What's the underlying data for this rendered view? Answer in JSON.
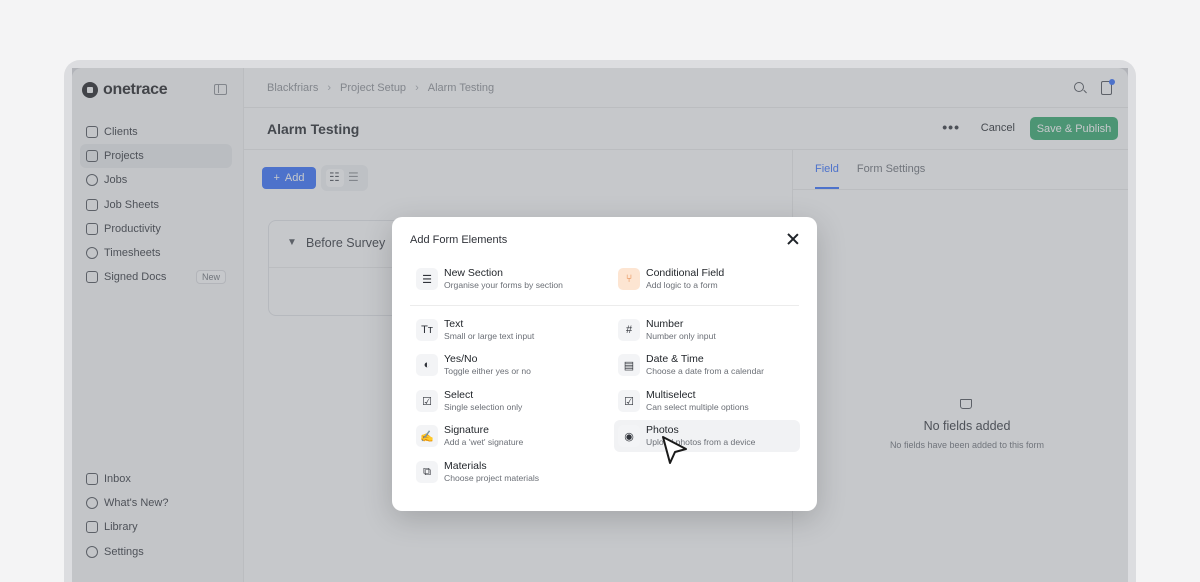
{
  "app": {
    "name": "onetrace"
  },
  "sidebar": {
    "items": [
      {
        "label": "Clients",
        "icon": "briefcase-icon"
      },
      {
        "label": "Projects",
        "icon": "cube-icon"
      },
      {
        "label": "Jobs",
        "icon": "helmet-icon"
      },
      {
        "label": "Job Sheets",
        "icon": "sheets-icon"
      },
      {
        "label": "Productivity",
        "icon": "chart-icon"
      },
      {
        "label": "Timesheets",
        "icon": "clock-icon"
      },
      {
        "label": "Signed Docs",
        "icon": "signature-icon",
        "badge": "New"
      }
    ],
    "bottom_items": [
      {
        "label": "Inbox",
        "icon": "inbox-icon"
      },
      {
        "label": "What's New?",
        "icon": "sparkle-icon"
      },
      {
        "label": "Library",
        "icon": "grid-icon"
      },
      {
        "label": "Settings",
        "icon": "gear-icon"
      }
    ],
    "active": "Projects"
  },
  "breadcrumb": [
    "Blackfriars",
    "Project Setup",
    "Alarm Testing"
  ],
  "header": {
    "title": "Alarm Testing",
    "more": "•••",
    "cancel": "Cancel",
    "publish": "Save & Publish"
  },
  "toolbar": {
    "add_label": "Add",
    "add_icon": "+"
  },
  "section": {
    "title": "Before Survey"
  },
  "panel": {
    "tabs": [
      "Field",
      "Form Settings"
    ],
    "active_tab": "Field",
    "empty_title": "No fields added",
    "empty_sub": "No fields have been added to this form"
  },
  "modal": {
    "title": "Add Form Elements",
    "options": [
      {
        "name": "New Section",
        "desc": "Organise your forms by section",
        "icon": "list-icon",
        "glyph": "☰"
      },
      {
        "name": "Conditional Field",
        "desc": "Add logic to a form",
        "icon": "branch-icon",
        "glyph": "⑂"
      },
      {
        "name": "Text",
        "desc": "Small or large text input",
        "icon": "text-icon",
        "glyph": "Tт"
      },
      {
        "name": "Number",
        "desc": "Number only input",
        "icon": "hash-icon",
        "glyph": "#"
      },
      {
        "name": "Yes/No",
        "desc": "Toggle either yes or no",
        "icon": "toggle-icon",
        "glyph": "◐"
      },
      {
        "name": "Date & Time",
        "desc": "Choose a date from a calendar",
        "icon": "calendar-icon",
        "glyph": "▤"
      },
      {
        "name": "Select",
        "desc": "Single selection only",
        "icon": "check-square-icon",
        "glyph": "☑"
      },
      {
        "name": "Multiselect",
        "desc": "Can select multiple options",
        "icon": "multi-check-icon",
        "glyph": "☑"
      },
      {
        "name": "Signature",
        "desc": "Add a 'wet' signature",
        "icon": "pen-icon",
        "glyph": "✍"
      },
      {
        "name": "Photos",
        "desc": "Upload photos from a device",
        "icon": "camera-icon",
        "glyph": "◉"
      },
      {
        "name": "Materials",
        "desc": "Choose project materials",
        "icon": "materials-icon",
        "glyph": "⧉"
      }
    ]
  },
  "colors": {
    "accent": "#2f6bff",
    "publish": "#2ea86a",
    "conditional": "#e2803f"
  }
}
